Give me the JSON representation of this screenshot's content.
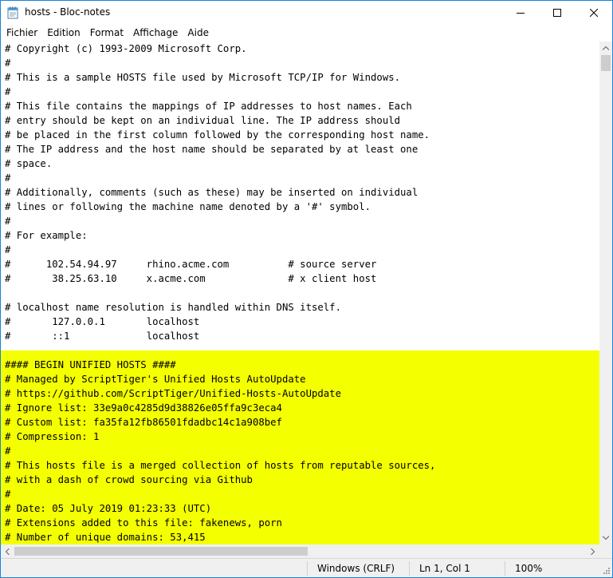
{
  "window": {
    "title": "hosts - Bloc-notes"
  },
  "menu": [
    "Fichier",
    "Edition",
    "Format",
    "Affichage",
    "Aide"
  ],
  "editor": {
    "lines": [
      "# Copyright (c) 1993-2009 Microsoft Corp.",
      "#",
      "# This is a sample HOSTS file used by Microsoft TCP/IP for Windows.",
      "#",
      "# This file contains the mappings of IP addresses to host names. Each",
      "# entry should be kept on an individual line. The IP address should",
      "# be placed in the first column followed by the corresponding host name.",
      "# The IP address and the host name should be separated by at least one",
      "# space.",
      "#",
      "# Additionally, comments (such as these) may be inserted on individual",
      "# lines or following the machine name denoted by a '#' symbol.",
      "#",
      "# For example:",
      "#",
      "#      102.54.94.97     rhino.acme.com          # source server",
      "#       38.25.63.10     x.acme.com              # x client host",
      "",
      "# localhost name resolution is handled within DNS itself.",
      "#\t127.0.0.1       localhost",
      "#\t::1             localhost",
      "",
      "#### BEGIN UNIFIED HOSTS ####",
      "# Managed by ScriptTiger's Unified Hosts AutoUpdate",
      "# https://github.com/ScriptTiger/Unified-Hosts-AutoUpdate",
      "# Ignore list: 33e9a0c4285d9d38826e05ffa9c3eca4",
      "# Custom list: fa35fa12fb86501fdadbc14c1a908bef",
      "# Compression: 1",
      "#",
      "# This hosts file is a merged collection of hosts from reputable sources,",
      "# with a dash of crowd sourcing via Github",
      "#",
      "# Date: 05 July 2019 01:23:33 (UTC)",
      "# Extensions added to this file: fakenews, porn",
      "# Number of unique domains: 53,415"
    ]
  },
  "statusbar": {
    "encoding": "Windows (CRLF)",
    "position": "Ln 1, Col 1",
    "zoom": "100%"
  },
  "colors": {
    "highlight": "#f4ff00",
    "border": "#1883d7"
  }
}
